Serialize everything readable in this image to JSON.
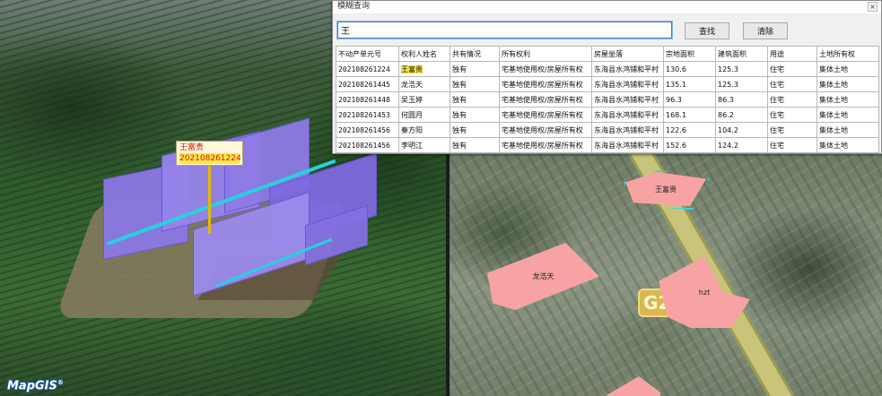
{
  "dialog": {
    "title": "模糊查询",
    "close_label": "×",
    "search_value": "王",
    "find_label": "查找",
    "clear_label": "清除"
  },
  "table": {
    "headers": [
      "不动产单元号",
      "权利人姓名",
      "共有情况",
      "所有权利",
      "房屋坐落",
      "宗地面积",
      "建筑面积",
      "用途",
      "土地所有权"
    ],
    "rows": [
      {
        "id": "202108261224",
        "owner": "王富贵",
        "share": "独有",
        "rights": "宅基地使用权/房屋所有权",
        "location": "东海县水鸿铺和平村",
        "land_area": "130.6",
        "floor_area": "125.3",
        "use": "住宅",
        "land_owner": "集体土地",
        "highlight": true
      },
      {
        "id": "202108261445",
        "owner": "龙浩天",
        "share": "独有",
        "rights": "宅基地使用权/房屋所有权",
        "location": "东海县水鸿铺和平村",
        "land_area": "135.1",
        "floor_area": "125.3",
        "use": "住宅",
        "land_owner": "集体土地"
      },
      {
        "id": "202108261448",
        "owner": "吴玉婷",
        "share": "独有",
        "rights": "宅基地使用权/房屋所有权",
        "location": "东海县水鸿铺和平村",
        "land_area": "96.3",
        "floor_area": "86.3",
        "use": "住宅",
        "land_owner": "集体土地"
      },
      {
        "id": "202108261453",
        "owner": "何圆月",
        "share": "独有",
        "rights": "宅基地使用权/房屋所有权",
        "location": "东海县水鸿铺和平村",
        "land_area": "168.1",
        "floor_area": "86.2",
        "use": "住宅",
        "land_owner": "集体土地"
      },
      {
        "id": "202108261456",
        "owner": "秦方阳",
        "share": "独有",
        "rights": "宅基地使用权/房屋所有权",
        "location": "东海县水鸿铺和平村",
        "land_area": "122.6",
        "floor_area": "104.2",
        "use": "住宅",
        "land_owner": "集体土地"
      },
      {
        "id": "202108261456",
        "owner": "李明江",
        "share": "独有",
        "rights": "宅基地使用权/房屋所有权",
        "location": "东海县水鸿铺和平村",
        "land_area": "152.6",
        "floor_area": "124.2",
        "use": "住宅",
        "land_owner": "集体土地"
      }
    ]
  },
  "view3d": {
    "pin_name": "王富贵",
    "pin_code": "202108261224",
    "logo_text": "MapGIS"
  },
  "map2d": {
    "parcel_wang": "王富贵",
    "parcel_long": "龙浩天",
    "parcel_hzt": "hzt",
    "road_label": "G2"
  },
  "colors": {
    "building": "#8b78e6",
    "parcel": "#f7a3a3",
    "parcel_outline": "#2fd8e6",
    "highlight": "#ffe84a",
    "label_red": "#e01010"
  }
}
